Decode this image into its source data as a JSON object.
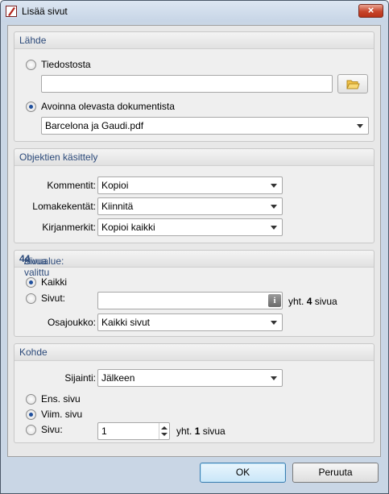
{
  "window": {
    "title": "Lisää sivut",
    "close_label": "×"
  },
  "source": {
    "header": "Lähde",
    "from_file_label": "Tiedostosta",
    "file_path_value": "",
    "open_document_label": "Avoinna olevasta dokumentista",
    "document_selected": "Barcelona ja Gaudi.pdf",
    "selected_option": "open_document"
  },
  "objects": {
    "header": "Objektien käsittely",
    "comments_label": "Kommentit:",
    "comments_value": "Kopioi",
    "form_fields_label": "Lomakekentät:",
    "form_fields_value": "Kiinnitä",
    "bookmarks_label": "Kirjanmerkit:",
    "bookmarks_value": "Kopioi kaikki"
  },
  "page_range": {
    "header_prefix": "Sivualue: valittu ",
    "selected_count": "4",
    "header_sep": " / ",
    "total_count": "4",
    "header_suffix": " sivua",
    "all_label": "Kaikki",
    "pages_label": "Sivut:",
    "pages_value": "",
    "info_icon_glyph": "i",
    "total_prefix": "yht. ",
    "total_value": "4",
    "total_suffix": " sivua",
    "subset_label": "Osajoukko:",
    "subset_value": "Kaikki sivut",
    "selected_option": "all"
  },
  "target": {
    "header": "Kohde",
    "position_label": "Sijainti:",
    "position_value": "Jälkeen",
    "first_page_label": "Ens. sivu",
    "last_page_label": "Viim. sivu",
    "page_label": "Sivu:",
    "page_value": "1",
    "total_prefix": "yht. ",
    "total_value": "1",
    "total_suffix": " sivua",
    "selected_option": "last_page"
  },
  "buttons": {
    "ok": "OK",
    "cancel": "Peruuta"
  },
  "colors": {
    "accent": "#1f4f9c",
    "group_header_text": "#2c4a7a",
    "close_button": "#c7452b"
  }
}
